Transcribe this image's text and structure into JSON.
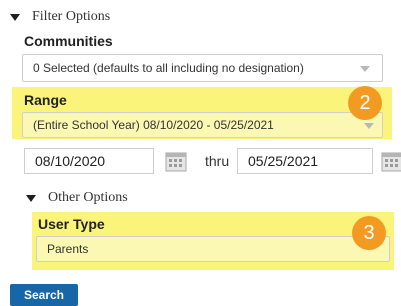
{
  "filter": {
    "header": "Filter Options"
  },
  "communities": {
    "label": "Communities",
    "value": "0 Selected (defaults to all including no designation)"
  },
  "range": {
    "label": "Range",
    "value": "(Entire School Year) 08/10/2020 - 05/25/2021",
    "badge": "2"
  },
  "dates": {
    "from": "08/10/2020",
    "thru_label": "thru",
    "to": "05/25/2021"
  },
  "other": {
    "header": "Other Options"
  },
  "user_type": {
    "label": "User Type",
    "value": "Parents",
    "badge": "3"
  },
  "search": {
    "label": "Search"
  },
  "colors": {
    "highlight": "#faf57a",
    "badge": "#f39a23",
    "button": "#1766a8"
  },
  "icons": [
    "triangle-down-icon",
    "calendar-icon",
    "chevron-down-icon"
  ]
}
